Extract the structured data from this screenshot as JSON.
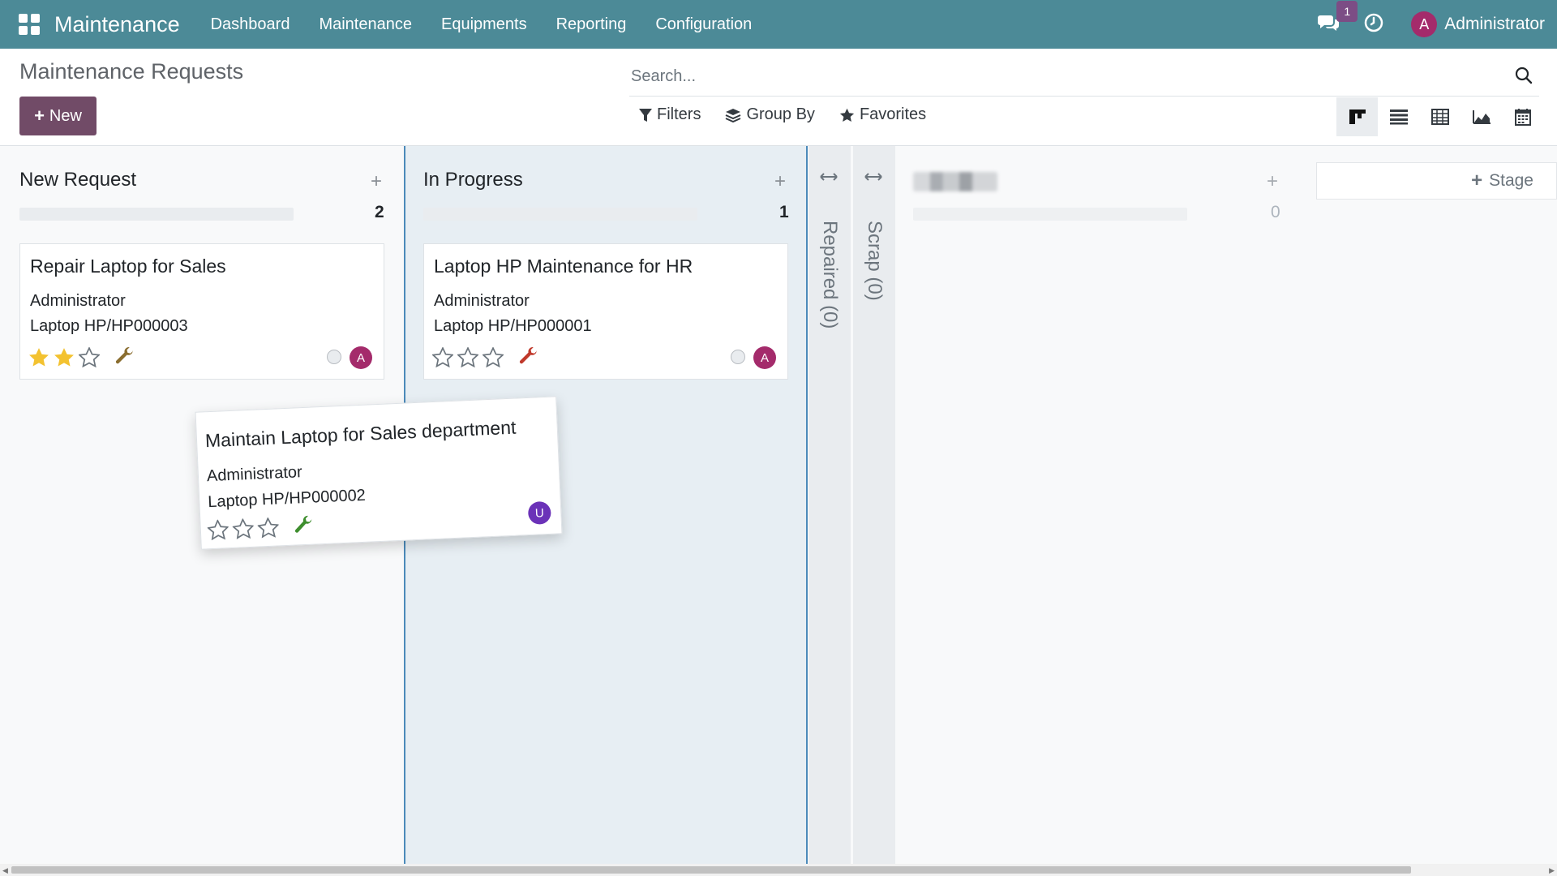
{
  "navbar": {
    "app_name": "Maintenance",
    "menu": [
      "Dashboard",
      "Maintenance",
      "Equipments",
      "Reporting",
      "Configuration"
    ],
    "messages_count": "1",
    "user_initial": "A",
    "user_name": "Administrator",
    "color": "#4c8a97"
  },
  "control": {
    "title": "Maintenance Requests",
    "new_label": "New",
    "search_placeholder": "Search...",
    "filters_label": "Filters",
    "groupby_label": "Group By",
    "favorites_label": "Favorites",
    "views": [
      "kanban",
      "list",
      "pivot",
      "graph",
      "calendar"
    ],
    "active_view": "kanban",
    "primary_color": "#714b67"
  },
  "columns": [
    {
      "title": "New Request",
      "count": "2",
      "cards": [
        {
          "title": "Repair Laptop for Sales",
          "user": "Administrator",
          "equipment": "Laptop HP/HP000003",
          "stars": 2,
          "avatar": "A",
          "wrench_color": "#8a6d2f"
        }
      ]
    },
    {
      "title": "In Progress",
      "count": "1",
      "cards": [
        {
          "title": "Laptop HP Maintenance for HR",
          "user": "Administrator",
          "equipment": "Laptop HP/HP000001",
          "stars": 0,
          "avatar": "A",
          "wrench_color": "#c0392b"
        }
      ]
    }
  ],
  "folded_columns": [
    {
      "label": "Repaired (0)"
    },
    {
      "label": "Scrap (0)"
    }
  ],
  "blurred_column": {
    "count": "0"
  },
  "add_stage_label": "Stage",
  "dragged_card": {
    "title": "Maintain Laptop for Sales department",
    "user": "Administrator",
    "equipment": "Laptop HP/HP000002",
    "stars": 0,
    "avatar": "U",
    "wrench_color": "#3e8e2e"
  }
}
